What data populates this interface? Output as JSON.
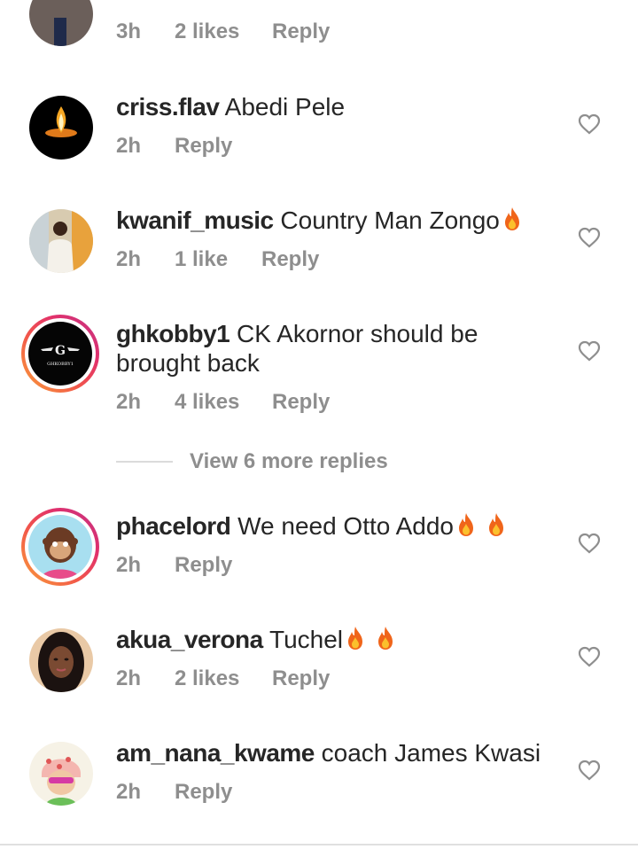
{
  "top_partial": {
    "time": "3h",
    "likes": "2 likes",
    "reply": "Reply"
  },
  "comments": [
    {
      "username": "criss.flav",
      "text": "Abedi Pele",
      "fire": 0,
      "time": "2h",
      "likes": "",
      "reply": "Reply"
    },
    {
      "username": "kwanif_music",
      "text": "Country Man Zongo",
      "fire": 1,
      "time": "2h",
      "likes": "1 like",
      "reply": "Reply"
    },
    {
      "username": "ghkobby1",
      "text": "CK Akornor should be brought back",
      "fire": 0,
      "time": "2h",
      "likes": "4 likes",
      "reply": "Reply",
      "avatar_text": "GHKOBBY1"
    },
    {
      "username": "phacelord",
      "text": "We need Otto Addo",
      "fire": 2,
      "time": "2h",
      "likes": "",
      "reply": "Reply"
    },
    {
      "username": "akua_verona",
      "text": "Tuchel",
      "fire": 2,
      "time": "2h",
      "likes": "2 likes",
      "reply": "Reply"
    },
    {
      "username": "am_nana_kwame",
      "text": "coach James Kwasi",
      "fire": 0,
      "time": "2h",
      "likes": "",
      "reply": "Reply"
    }
  ],
  "view_more_replies": "View 6 more replies",
  "icons": {
    "like": "heart-outline-icon",
    "emoji": "fire-emoji"
  },
  "colors": {
    "text": "#262626",
    "secondary": "#8e8e8e",
    "story_ring_start": "#f9a13a",
    "story_ring_end": "#c13584"
  }
}
